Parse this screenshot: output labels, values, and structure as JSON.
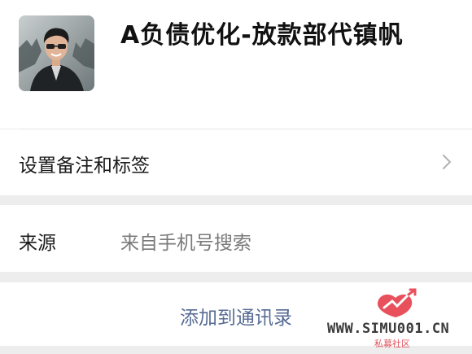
{
  "contact": {
    "display_name": "A负债优化-放款部代镇帆",
    "avatar_icon": "profile-photo"
  },
  "rows": {
    "remark_label": "设置备注和标签",
    "source_label": "来源",
    "source_value": "来自手机号搜索",
    "add_button_label": "添加到通讯录"
  },
  "watermark": {
    "url": "WWW.SIMU001.CN",
    "subtitle": "私募社区"
  },
  "colors": {
    "background": "#ededed",
    "card": "#ffffff",
    "link_blue": "#576b95",
    "secondary_text": "#7a7a7a"
  }
}
